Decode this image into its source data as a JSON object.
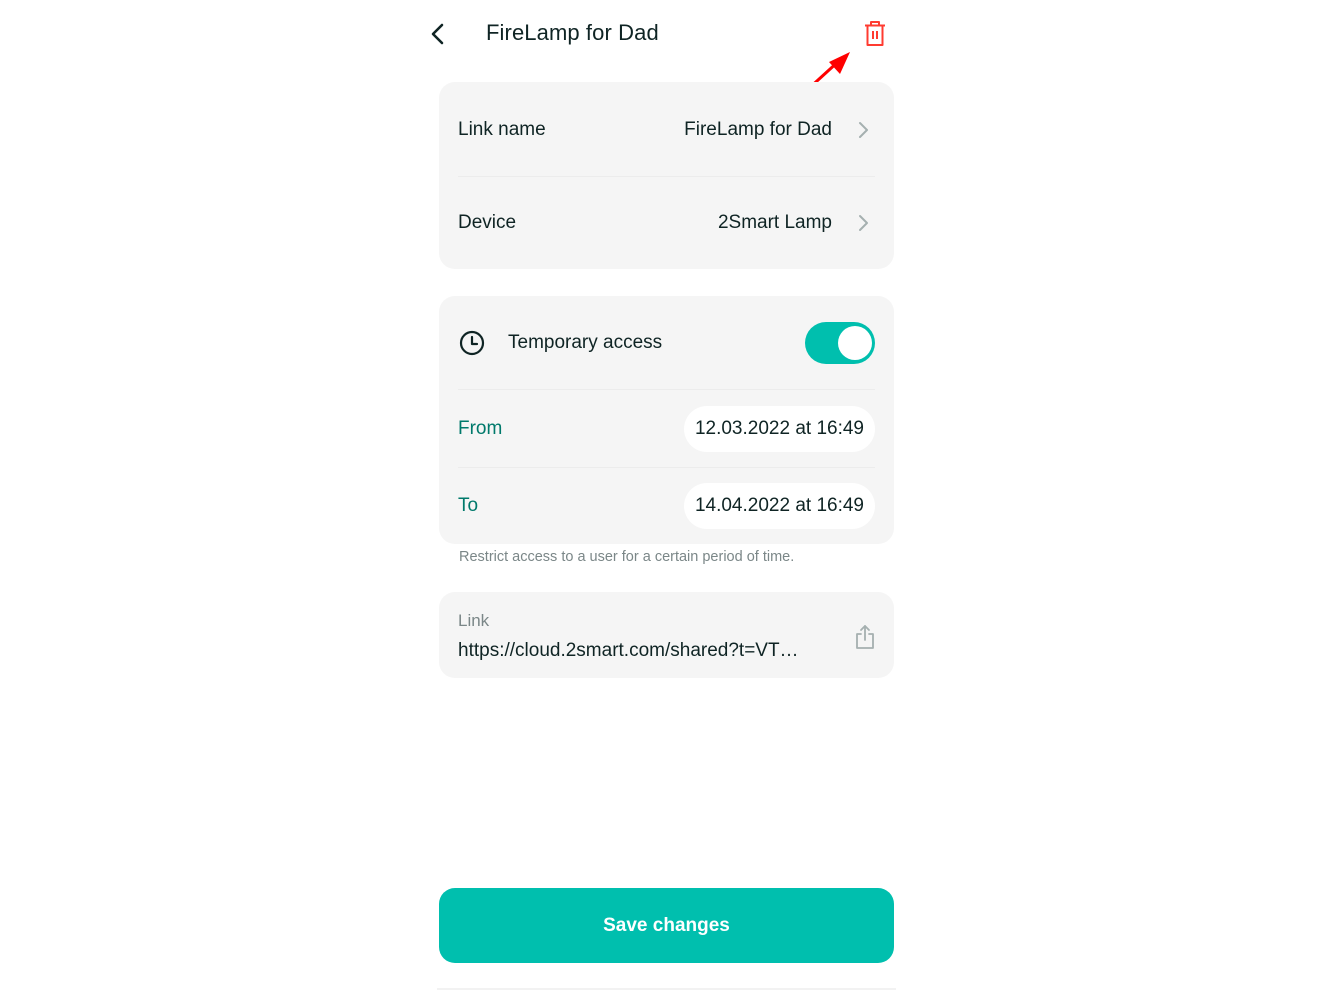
{
  "header": {
    "title": "FireLamp for Dad",
    "back_icon": "chevron-left-icon",
    "delete_icon": "trash-icon",
    "delete_icon_color": "#ff3b30"
  },
  "details": {
    "rows": [
      {
        "label": "Link name",
        "value": "FireLamp for Dad",
        "icon": "chevron-right-icon"
      },
      {
        "label": "Device",
        "value": "2Smart Lamp",
        "icon": "chevron-right-icon"
      }
    ]
  },
  "temporary_access": {
    "icon": "clock-icon",
    "label": "Temporary access",
    "enabled": true,
    "from_label": "From",
    "from_value": "12.03.2022 at 16:49",
    "to_label": "To",
    "to_value": "14.04.2022 at 16:49",
    "hint": "Restrict access to a user for a certain period of time."
  },
  "link": {
    "label": "Link",
    "value": "https://cloud.2smart.com/shared?t=VT…",
    "share_icon": "share-icon"
  },
  "footer": {
    "save_label": "Save changes"
  },
  "colors": {
    "accent": "#00bfae",
    "teal_text": "#00796b",
    "card_bg": "#f5f5f5",
    "annotation_arrow": "#ff0000"
  }
}
